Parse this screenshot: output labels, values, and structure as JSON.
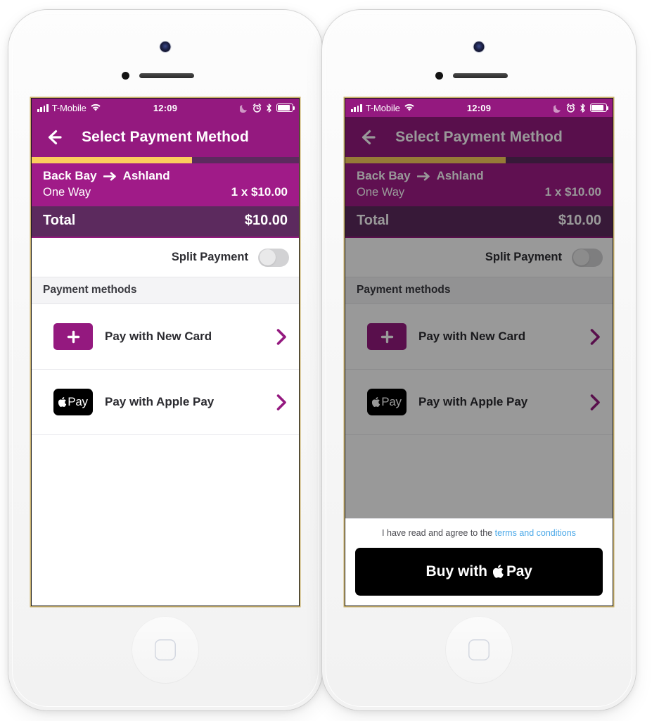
{
  "phones": [
    {
      "id": "left",
      "name": "phone-default-state",
      "dimmed": false,
      "show_sheet": false
    },
    {
      "id": "right",
      "name": "phone-apple-pay-sheet-state",
      "dimmed": true,
      "show_sheet": true
    }
  ],
  "status_bar": {
    "carrier": "T-Mobile",
    "time": "12:09",
    "signal_icon": "signal-bars-icon",
    "wifi_icon": "wifi-icon",
    "moon_icon": "do-not-disturb-moon-icon",
    "alarm_icon": "alarm-clock-icon",
    "bluetooth_icon": "bluetooth-icon",
    "battery_icon": "battery-icon",
    "battery_level": "88%"
  },
  "nav": {
    "title": "Select Payment Method",
    "back_icon": "back-arrow-icon"
  },
  "progress": {
    "percent": "60%",
    "fill_color": "#fbcd5d",
    "track_color": "#5c2a5e"
  },
  "trip": {
    "origin": "Back Bay",
    "destination": "Ashland",
    "arrow_icon": "right-arrow-icon",
    "trip_type": "One Way",
    "quantity_price": "1 x $10.00",
    "background": "#a01b88"
  },
  "total": {
    "label": "Total",
    "amount": "$10.00",
    "background": "#5c2a5e"
  },
  "split_payment": {
    "label": "Split Payment",
    "toggle_state": "off"
  },
  "payment_methods": {
    "section_title": "Payment methods",
    "items": [
      {
        "label": "Pay with New Card",
        "icon": "plus-card-icon",
        "icon_background": "#94197f",
        "chevron_icon": "chevron-right-icon"
      },
      {
        "label": "Pay with Apple Pay",
        "icon": "apple-pay-logo-icon",
        "icon_background": "#000000",
        "icon_text": "Pay",
        "chevron_icon": "chevron-right-icon"
      }
    ]
  },
  "action_sheet": {
    "terms_prefix": "I have read and agree to the ",
    "terms_link": "terms and conditions",
    "buy_prefix": "Buy with ",
    "buy_suffix": "Pay",
    "apple_glyph_icon": "apple-logo-icon",
    "button_background": "#000000",
    "link_color": "#4aa8e8"
  },
  "theme": {
    "brand_purple": "#94197f",
    "trip_purple": "#a01b88",
    "dark_purple": "#5c2a5e",
    "accent_yellow": "#fbcd5d",
    "dim_overlay": "rgba(0,0,0,0.40)"
  }
}
